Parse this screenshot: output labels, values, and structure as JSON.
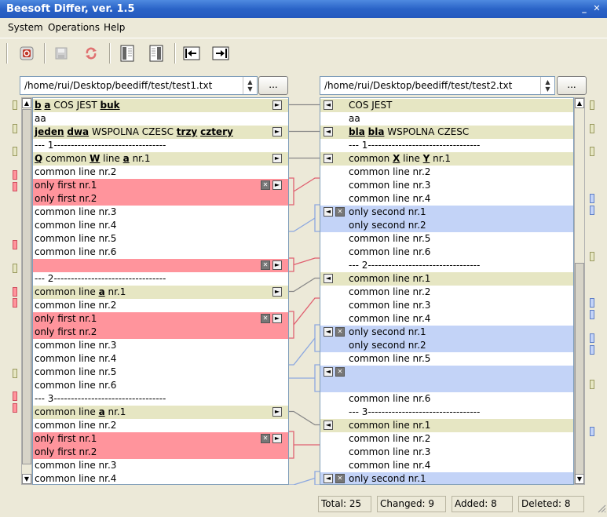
{
  "window": {
    "title": "Beesoft Differ, ver. 1.5",
    "buttons": [
      {
        "name": "minimize",
        "glyph": "_"
      },
      {
        "name": "close",
        "glyph": "✕"
      }
    ]
  },
  "menu": [
    {
      "label": "System"
    },
    {
      "label": "Operations"
    },
    {
      "label": "Help"
    }
  ],
  "toolbar": {
    "buttons": [
      {
        "name": "exit-icon"
      },
      {
        "name": "save-icon"
      },
      {
        "name": "refresh-icon"
      },
      {
        "name": "open-left-icon"
      },
      {
        "name": "open-right-icon"
      },
      {
        "name": "previous-diff-icon"
      },
      {
        "name": "next-diff-icon"
      }
    ]
  },
  "left": {
    "path": "/home/rui/Desktop/beediff/test/test1.txt",
    "browse": "...",
    "lines": [
      {
        "kind": "changed",
        "segs": [
          [
            "b",
            true
          ],
          [
            " ",
            false
          ],
          [
            "a",
            true
          ],
          [
            " COS JEST ",
            false
          ],
          [
            "buk",
            true
          ]
        ],
        "act": [
          "►"
        ]
      },
      {
        "kind": "plain",
        "text": "aa"
      },
      {
        "kind": "changed",
        "segs": [
          [
            "jeden",
            true
          ],
          [
            " ",
            false
          ],
          [
            "dwa",
            true
          ],
          [
            " WSPOLNA CZESC ",
            false
          ],
          [
            "trzy",
            true
          ],
          [
            " ",
            false
          ],
          [
            "cztery",
            true
          ]
        ],
        "act": [
          "►"
        ]
      },
      {
        "kind": "plain",
        "text": "--- 1---------------------------------"
      },
      {
        "kind": "changed",
        "segs": [
          [
            "Q",
            true
          ],
          [
            " common ",
            false
          ],
          [
            "W",
            true
          ],
          [
            " line ",
            false
          ],
          [
            "a",
            true
          ],
          [
            " nr.1",
            false
          ]
        ],
        "act": [
          "►"
        ]
      },
      {
        "kind": "plain",
        "text": "common line nr.2"
      },
      {
        "kind": "deleted",
        "text": "only first nr.1",
        "act": [
          "✕",
          "►"
        ]
      },
      {
        "kind": "deleted",
        "text": "only first nr.2"
      },
      {
        "kind": "plain",
        "text": "common line nr.3"
      },
      {
        "kind": "plain",
        "text": "common line nr.4"
      },
      {
        "kind": "plain",
        "text": "common line nr.5"
      },
      {
        "kind": "plain",
        "text": "common line nr.6"
      },
      {
        "kind": "deleted",
        "text": "",
        "act": [
          "✕",
          "►"
        ]
      },
      {
        "kind": "plain",
        "text": "--- 2---------------------------------"
      },
      {
        "kind": "changed",
        "segs": [
          [
            "common line ",
            false
          ],
          [
            "a",
            true
          ],
          [
            " nr.1",
            false
          ]
        ],
        "act": [
          "►"
        ]
      },
      {
        "kind": "plain",
        "text": "common line nr.2"
      },
      {
        "kind": "deleted",
        "text": "only first nr.1",
        "act": [
          "✕",
          "►"
        ]
      },
      {
        "kind": "deleted",
        "text": "only first nr.2"
      },
      {
        "kind": "plain",
        "text": "common line nr.3"
      },
      {
        "kind": "plain",
        "text": "common line nr.4"
      },
      {
        "kind": "plain",
        "text": "common line nr.5"
      },
      {
        "kind": "plain",
        "text": "common line nr.6"
      },
      {
        "kind": "plain",
        "text": "--- 3---------------------------------"
      },
      {
        "kind": "changed",
        "segs": [
          [
            "common line ",
            false
          ],
          [
            "a",
            true
          ],
          [
            " nr.1",
            false
          ]
        ],
        "act": [
          "►"
        ]
      },
      {
        "kind": "plain",
        "text": "common line nr.2"
      },
      {
        "kind": "deleted",
        "text": "only first nr.1",
        "act": [
          "✕",
          "►"
        ]
      },
      {
        "kind": "deleted",
        "text": "only first nr.2"
      },
      {
        "kind": "plain",
        "text": "common line nr.3"
      },
      {
        "kind": "plain",
        "text": "common line nr.4"
      }
    ]
  },
  "right": {
    "path": "/home/rui/Desktop/beediff/test/test2.txt",
    "browse": "...",
    "lines": [
      {
        "kind": "changed",
        "segs": [
          [
            "COS JEST",
            false
          ]
        ],
        "act": [
          "◄"
        ]
      },
      {
        "kind": "plain",
        "text": "aa"
      },
      {
        "kind": "changed",
        "segs": [
          [
            "bla",
            true
          ],
          [
            " ",
            false
          ],
          [
            "bla",
            true
          ],
          [
            " WSPOLNA CZESC",
            false
          ]
        ],
        "act": [
          "◄"
        ]
      },
      {
        "kind": "plain",
        "text": "--- 1---------------------------------"
      },
      {
        "kind": "changed",
        "segs": [
          [
            "common ",
            false
          ],
          [
            "X",
            true
          ],
          [
            " line ",
            false
          ],
          [
            "Y",
            true
          ],
          [
            " nr.1",
            false
          ]
        ],
        "act": [
          "◄"
        ]
      },
      {
        "kind": "plain",
        "text": "common line nr.2"
      },
      {
        "kind": "plain",
        "text": "common line nr.3"
      },
      {
        "kind": "plain",
        "text": "common line nr.4"
      },
      {
        "kind": "added",
        "text": "only second nr.1",
        "act": [
          "◄",
          "✕"
        ]
      },
      {
        "kind": "added",
        "text": "only second nr.2"
      },
      {
        "kind": "plain",
        "text": "common line nr.5"
      },
      {
        "kind": "plain",
        "text": "common line nr.6"
      },
      {
        "kind": "plain",
        "text": "--- 2---------------------------------"
      },
      {
        "kind": "changed",
        "segs": [
          [
            "common line nr.1",
            false
          ]
        ],
        "act": [
          "◄"
        ]
      },
      {
        "kind": "plain",
        "text": "common line nr.2"
      },
      {
        "kind": "plain",
        "text": "common line nr.3"
      },
      {
        "kind": "plain",
        "text": "common line nr.4"
      },
      {
        "kind": "added",
        "text": "only second nr.1",
        "act": [
          "◄",
          "✕"
        ]
      },
      {
        "kind": "added",
        "text": "only second nr.2"
      },
      {
        "kind": "plain",
        "text": "common line nr.5"
      },
      {
        "kind": "added",
        "text": "",
        "act": [
          "◄",
          "✕"
        ]
      },
      {
        "kind": "added",
        "text": ""
      },
      {
        "kind": "plain",
        "text": "common line nr.6"
      },
      {
        "kind": "plain",
        "text": "--- 3---------------------------------"
      },
      {
        "kind": "changed",
        "segs": [
          [
            "common line nr.1",
            false
          ]
        ],
        "act": [
          "◄"
        ]
      },
      {
        "kind": "plain",
        "text": "common line nr.2"
      },
      {
        "kind": "plain",
        "text": "common line nr.3"
      },
      {
        "kind": "plain",
        "text": "common line nr.4"
      },
      {
        "kind": "added",
        "text": "only second nr.1",
        "act": [
          "◄",
          "✕"
        ]
      }
    ]
  },
  "status": {
    "total": "Total: 25",
    "changed": "Changed: 9",
    "added": "Added: 8",
    "deleted": "Deleted: 8"
  },
  "colors": {
    "changed": "#e6e6c3",
    "deleted": "#ff949c",
    "added": "#c3d3f7",
    "changed_link": "#888888",
    "deleted_link": "#e06070",
    "added_link": "#8ca8e0",
    "titlebar": "#2a63c7"
  }
}
